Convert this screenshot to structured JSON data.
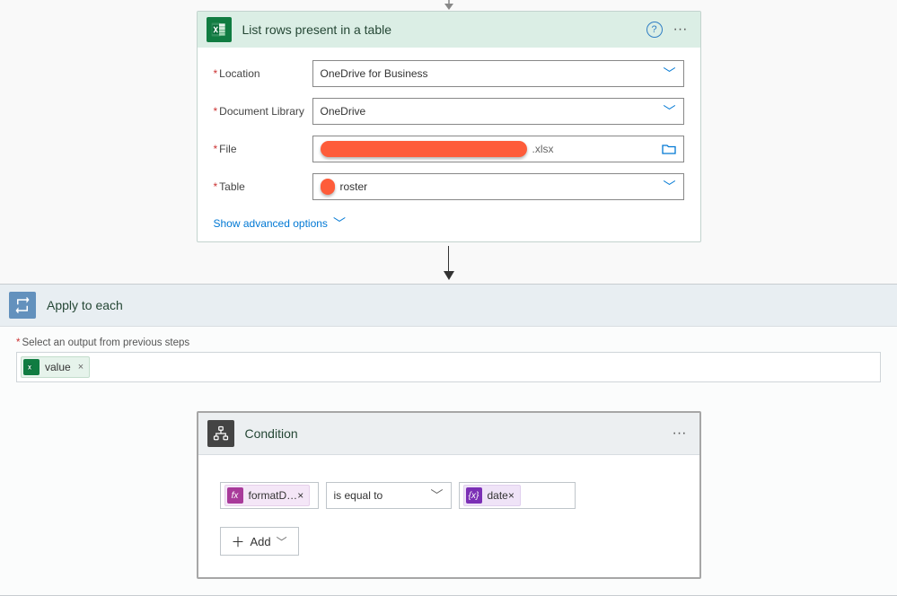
{
  "topArrow": "▽",
  "excelCard": {
    "title": "List rows present in a table",
    "fields": {
      "locationLabel": "Location",
      "locationValue": "OneDrive for Business",
      "docLibLabel": "Document Library",
      "docLibValue": "OneDrive",
      "fileLabel": "File",
      "fileSuffix": ".xlsx",
      "tableLabel": "Table",
      "tableValue": "roster"
    },
    "advanced": "Show advanced options",
    "helpGlyph": "?",
    "moreGlyph": "···"
  },
  "applyEach": {
    "title": "Apply to each",
    "selectLabel": "Select an output from previous steps",
    "token": "value",
    "tokenClose": "×"
  },
  "condition": {
    "title": "Condition",
    "moreGlyph": "···",
    "left": {
      "badge": "fx",
      "label": "formatD…",
      "close": "×"
    },
    "comparator": "is equal to",
    "right": {
      "badge": "{x}",
      "label": "date",
      "close": "×"
    },
    "addLabel": "Add",
    "plus": "＋"
  },
  "glyphs": {
    "chevDown": "﹀"
  }
}
